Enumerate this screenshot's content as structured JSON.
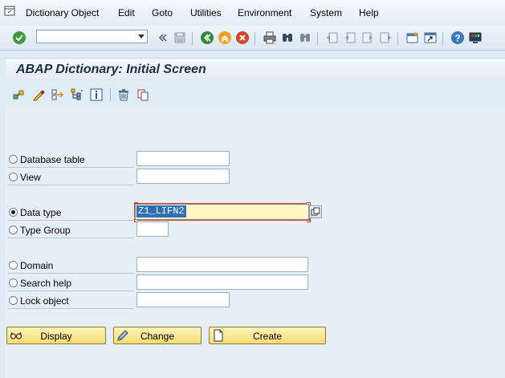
{
  "menu": {
    "items": [
      "Dictionary Object",
      "Edit",
      "Goto",
      "Utilities",
      "Environment",
      "System",
      "Help"
    ]
  },
  "toolbar": {
    "command_value": "",
    "icons": [
      "enter-icon",
      "command-field-dropdown",
      "back-double-icon",
      "save-icon",
      "back-icon",
      "exit-icon",
      "cancel-icon",
      "print-icon",
      "find-icon",
      "find-next-icon",
      "first-page-icon",
      "previous-page-icon",
      "next-page-icon",
      "last-page-icon",
      "create-session-icon",
      "shortcut-icon",
      "help-icon",
      "customize-layout-icon"
    ]
  },
  "title": "ABAP Dictionary: Initial Screen",
  "app_toolbar": {
    "icons": [
      "other-object-icon",
      "edit-object-icon",
      "where-used-icon",
      "object-tree-icon",
      "info-icon",
      "delete-icon",
      "copy-icon"
    ]
  },
  "form": {
    "database_table": {
      "label": "Database table",
      "value": ""
    },
    "view": {
      "label": "View",
      "value": ""
    },
    "data_type": {
      "label": "Data type",
      "value": "Z1_LIFN2"
    },
    "type_group": {
      "label": "Type Group",
      "value": ""
    },
    "domain": {
      "label": "Domain",
      "value": ""
    },
    "search_help": {
      "label": "Search help",
      "value": ""
    },
    "lock_object": {
      "label": "Lock object",
      "value": ""
    }
  },
  "buttons": {
    "display": "Display",
    "change": "Change",
    "create": "Create"
  },
  "colors": {
    "background": "#dfebf5",
    "button_yellow": "#f5dc78",
    "focus_field": "#fff6c2",
    "selection": "#2f6fb5",
    "focus_marker": "#d63b2b"
  }
}
